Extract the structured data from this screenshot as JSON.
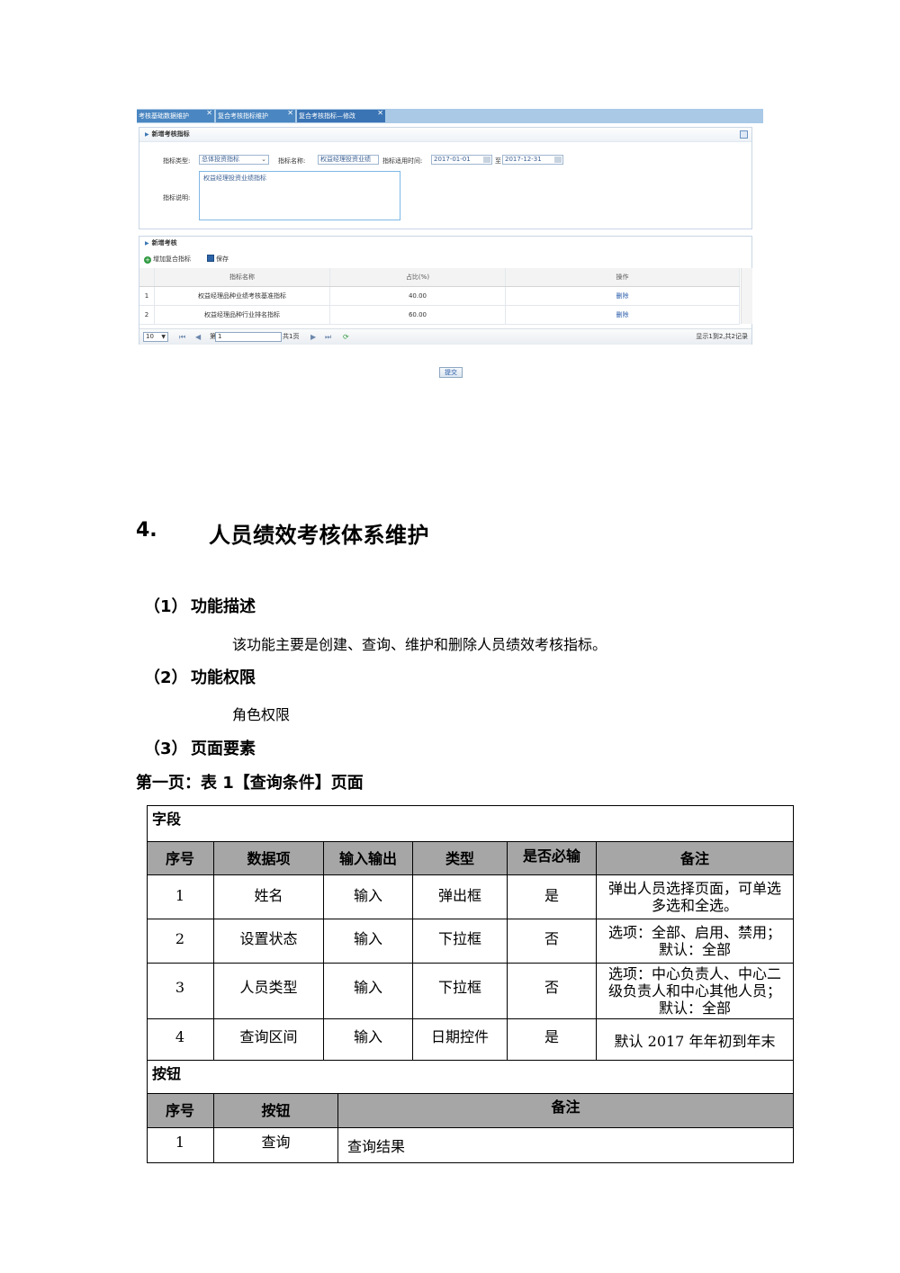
{
  "screenshot": {
    "tabs": [
      {
        "label": "考核基础数据维护"
      },
      {
        "label": "复合考核指标维护"
      },
      {
        "label": "复合考核指标—修改"
      }
    ],
    "tab_close": "✕",
    "panel_indicator": {
      "title": "新增考核指标",
      "type_label": "指标类型:",
      "type_value": "总体投资指标",
      "name_label": "指标名称:",
      "name_value": "权益经理投资业绩",
      "period_label": "指标适用时间:",
      "start_date": "2017-01-01",
      "to_label": "至",
      "end_date": "2017-12-31",
      "desc_label": "指标说明:",
      "desc_value": "权益经理投资业绩指标"
    },
    "panel_assess": {
      "title": "新增考核",
      "add_label": "增加复合指标",
      "save_label": "保存",
      "columns": [
        "指标名称",
        "占比(%)",
        "操作"
      ],
      "rows": [
        {
          "idx": "1",
          "name": "权益经理品种业绩考核基准指标",
          "ratio": "40.00",
          "action": "删除"
        },
        {
          "idx": "2",
          "name": "权益经理品种行业排名指标",
          "ratio": "60.00",
          "action": "删除"
        }
      ],
      "pager": {
        "page_size": "10",
        "page_prefix": "第",
        "page_value": "1",
        "page_total": "共1页",
        "summary": "显示1到2,共2记录"
      }
    },
    "submit_label": "提交"
  },
  "section": {
    "number": "4.",
    "title": "人员绩效考核体系维护"
  },
  "subsections": [
    {
      "number": "（1）",
      "title": "功能描述",
      "text": "该功能主要是创建、查询、维护和删除人员绩效考核指标。"
    },
    {
      "number": "（2）",
      "title": "功能权限",
      "text": "角色权限"
    },
    {
      "number": "（3）",
      "title": "页面要素"
    }
  ],
  "table_caption": "第一页：表 1【查询条件】页面",
  "table": {
    "fields_label": "字段",
    "field_headers": [
      "序号",
      "数据项",
      "输入输出",
      "类型",
      "是否必输",
      "备注"
    ],
    "field_rows": [
      [
        "1",
        "姓名",
        "输入",
        "弹出框",
        "是",
        "弹出人员选择页面，可单选多选和全选。"
      ],
      [
        "2",
        "设置状态",
        "输入",
        "下拉框",
        "否",
        "选项：全部、启用、禁用；默认：全部"
      ],
      [
        "3",
        "人员类型",
        "输入",
        "下拉框",
        "否",
        "选项：中心负责人、中心二级负责人和中心其他人员；默认：全部"
      ],
      [
        "4",
        "查询区间",
        "输入",
        "日期控件",
        "是",
        "默认 2017 年年初到年末"
      ]
    ],
    "buttons_label": "按钮",
    "button_headers": [
      "序号",
      "按钮",
      "备注"
    ],
    "button_rows": [
      [
        "1",
        "查询",
        "查询结果"
      ]
    ]
  }
}
